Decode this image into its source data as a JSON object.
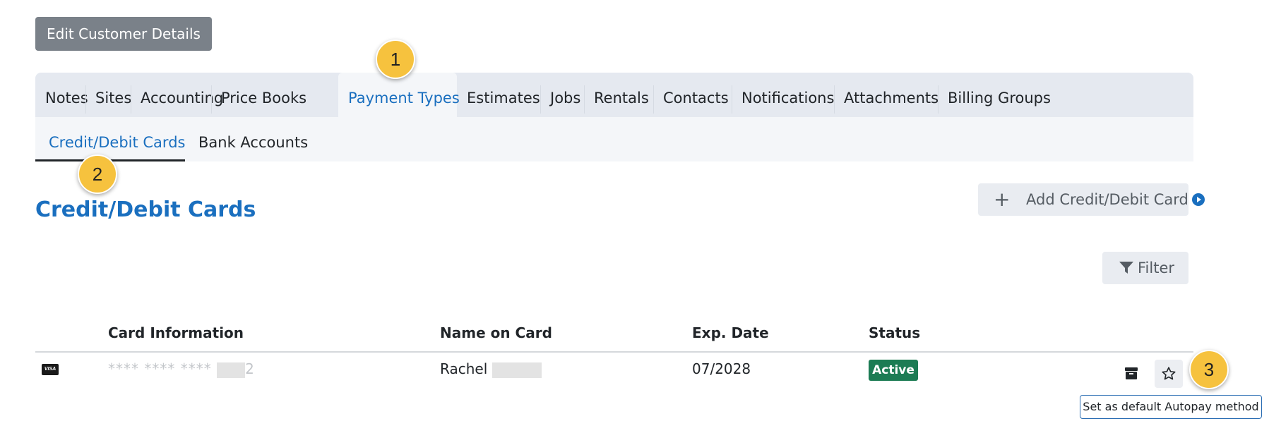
{
  "edit_button": {
    "label": "Edit Customer Details"
  },
  "tabs": [
    {
      "label": "Notes"
    },
    {
      "label": "Sites"
    },
    {
      "label": "Accounting"
    },
    {
      "label": "Price Books"
    },
    {
      "label": "Payment Types"
    },
    {
      "label": "Estimates"
    },
    {
      "label": "Jobs"
    },
    {
      "label": "Rentals"
    },
    {
      "label": "Contacts"
    },
    {
      "label": "Notifications"
    },
    {
      "label": "Attachments"
    },
    {
      "label": "Billing Groups"
    }
  ],
  "active_tab": "Payment Types",
  "subtabs": [
    {
      "label": "Credit/Debit Cards"
    },
    {
      "label": "Bank Accounts"
    }
  ],
  "active_subtab": "Credit/Debit Cards",
  "badges": [
    "1",
    "2",
    "3"
  ],
  "section": {
    "title": "Credit/Debit Cards",
    "add_button": "Add Credit/Debit Card",
    "filter_button": "Filter"
  },
  "table": {
    "columns": [
      "Card Information",
      "Name on Card",
      "Exp. Date",
      "Status"
    ],
    "rows": [
      {
        "card_brand_icon": "visa-icon",
        "card_info": "**** **** **** ",
        "card_last_digit": "2",
        "name_on_card": "Rachel",
        "exp_date": "07/2028",
        "status": "Active"
      }
    ]
  },
  "tooltip": "Set as default Autopay method",
  "colors": {
    "accent": "#1a6fbf",
    "badge": "#f6c23e",
    "status_active": "#1c7c54",
    "edit_button": "#7a8189"
  }
}
